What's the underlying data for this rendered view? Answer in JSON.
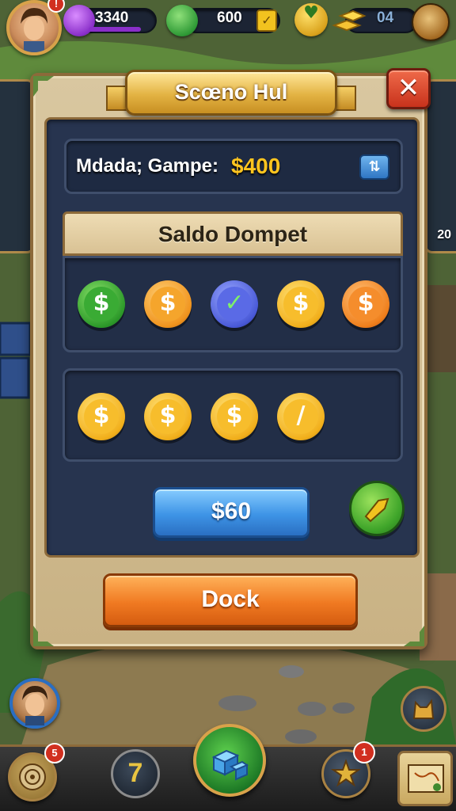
{
  "topbar": {
    "avatar_badge": "!",
    "gems": "3340",
    "cash": "600",
    "gold_count": "04"
  },
  "dialog": {
    "title": "Scœno Hul",
    "close_icon": "close-icon",
    "info_label": "Mdada; Gampe:",
    "info_value": "$400",
    "section_title": "Saldo Dompet",
    "amount_label": "$60",
    "dock_label": "Dock"
  },
  "coins_row1": [
    {
      "symbol": "$",
      "color": "green"
    },
    {
      "symbol": "$",
      "color": "orange"
    },
    {
      "symbol": "✓",
      "color": "blue"
    },
    {
      "symbol": "$",
      "color": "gold"
    },
    {
      "symbol": "$",
      "color": "orange"
    }
  ],
  "coins_row2": [
    {
      "symbol": "$",
      "color": "gold"
    },
    {
      "symbol": "$",
      "color": "gold"
    },
    {
      "symbol": "$",
      "color": "gold"
    },
    {
      "symbol": "/",
      "color": "gold"
    }
  ],
  "side": {
    "right_count": "20"
  },
  "bottombar": {
    "left_badge": "5",
    "seven_label": "7",
    "right_badge": "1"
  },
  "colors": {
    "accent_gold": "#ffc51f",
    "panel_navy": "#27344f",
    "button_blue": "#3e94e6",
    "button_orange": "#f07a22",
    "close_red": "#c8321c"
  }
}
